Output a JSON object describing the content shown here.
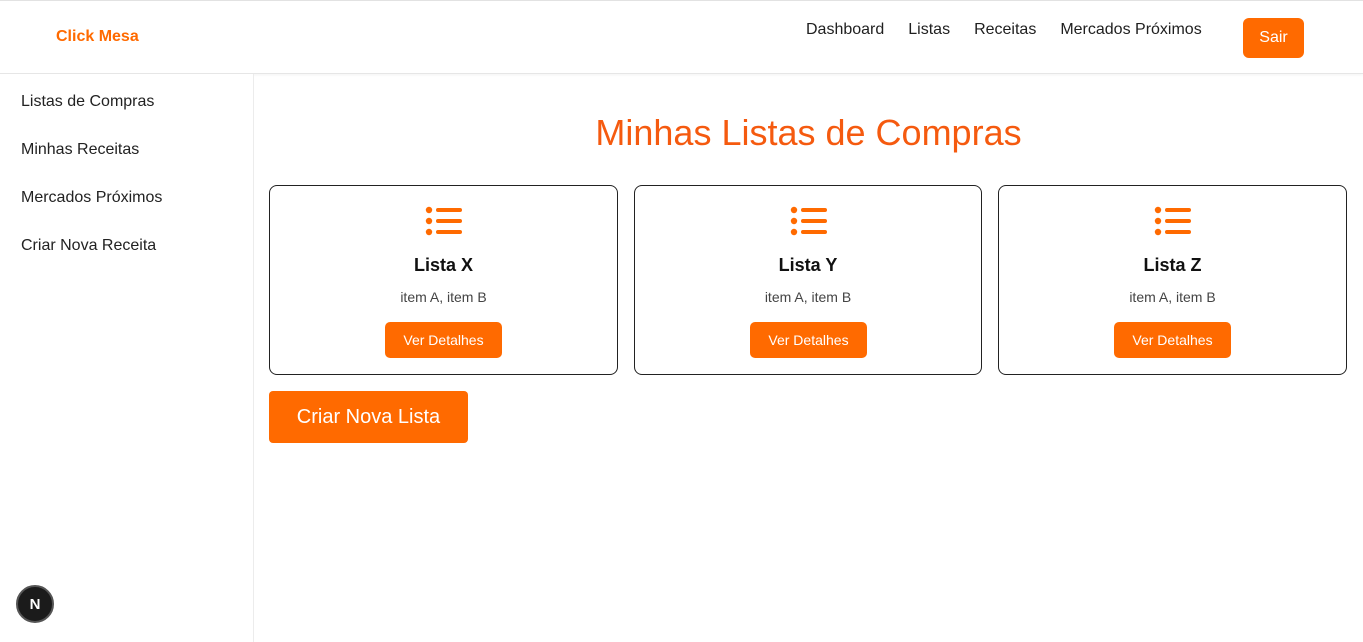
{
  "header": {
    "brand": "Click Mesa",
    "nav": [
      "Dashboard",
      "Listas",
      "Receitas",
      "Mercados Próximos"
    ],
    "logout_label": "Sair"
  },
  "sidebar": {
    "items": [
      "Listas de Compras",
      "Minhas Receitas",
      "Mercados Próximos",
      "Criar Nova Receita"
    ]
  },
  "main": {
    "title": "Minhas Listas de Compras",
    "cards": [
      {
        "title": "Lista X",
        "items": "item A, item B",
        "button": "Ver Detalhes",
        "icon": "list-icon"
      },
      {
        "title": "Lista Y",
        "items": "item A, item B",
        "button": "Ver Detalhes",
        "icon": "list-icon"
      },
      {
        "title": "Lista Z",
        "items": "item A, item B",
        "button": "Ver Detalhes",
        "icon": "list-icon"
      }
    ],
    "create_label": "Criar Nova Lista"
  },
  "badge": {
    "letter": "N",
    "icon": "nextjs-icon"
  },
  "colors": {
    "accent": "#ff6a00",
    "title": "#f55a0f"
  }
}
